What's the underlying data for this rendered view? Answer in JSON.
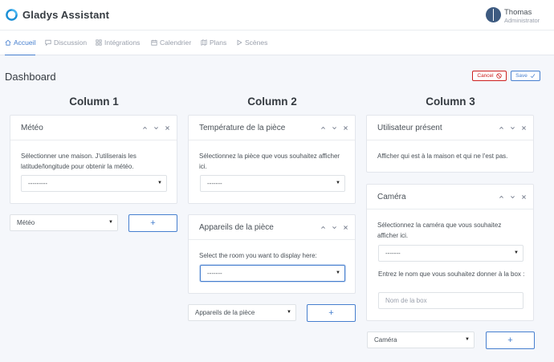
{
  "app": {
    "title": "Gladys Assistant"
  },
  "user": {
    "name": "Thomas",
    "role": "Administrator"
  },
  "nav": [
    {
      "label": "Accueil",
      "icon": "home-icon",
      "active": true
    },
    {
      "label": "Discussion",
      "icon": "chat-icon"
    },
    {
      "label": "Intégrations",
      "icon": "grid-icon"
    },
    {
      "label": "Calendrier",
      "icon": "calendar-icon"
    },
    {
      "label": "Plans",
      "icon": "map-icon"
    },
    {
      "label": "Scènes",
      "icon": "play-icon"
    }
  ],
  "page": {
    "title": "Dashboard",
    "cancel_label": "Cancel",
    "save_label": "Save"
  },
  "columns": [
    {
      "title": "Column 1",
      "boxes": [
        {
          "title": "Météo",
          "text": "Sélectionner une maison. J'utiliserais les latitude/longitude pour obtenir la météo.",
          "select_value": "---------"
        }
      ],
      "add_select": "Météo",
      "add_label": "+"
    },
    {
      "title": "Column 2",
      "boxes": [
        {
          "title": "Température de la pièce",
          "text": "Sélectionnez la pièce que vous souhaitez afficher ici.",
          "select_value": "-------"
        },
        {
          "title": "Appareils de la pièce",
          "text": "Select the room you want to display here:",
          "select_value": "-------"
        }
      ],
      "add_select": "Appareils de la pièce",
      "add_label": "+"
    },
    {
      "title": "Column 3",
      "boxes": [
        {
          "title": "Utilisateur présent",
          "text": "Afficher qui est à la maison et qui ne l'est pas."
        },
        {
          "title": "Caméra",
          "text": "Sélectionnez la caméra que vous souhaitez afficher ici.",
          "select_value": "-------",
          "input_label": "Entrez le nom que vous souhaitez donner à la box :",
          "input_placeholder": "Nom de la box"
        }
      ],
      "add_select": "Caméra",
      "add_label": "+"
    }
  ],
  "colors": {
    "primary": "#467fcf",
    "danger": "#cd201f",
    "background": "#f5f7fb"
  }
}
